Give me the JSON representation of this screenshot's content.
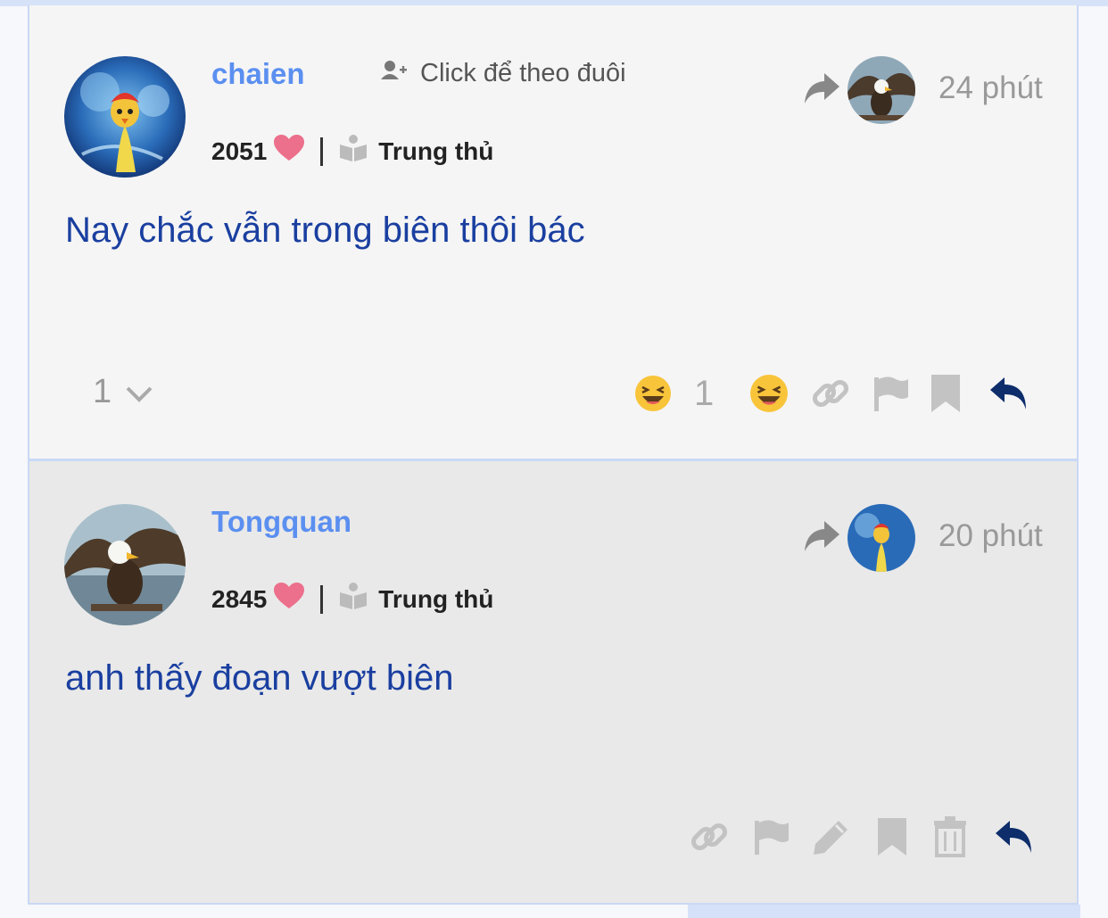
{
  "posts": [
    {
      "username": "chaien",
      "follow_label": "Click để theo đuôi",
      "likes": "2051",
      "rank": "Trung thủ",
      "time": "24 phút",
      "content": "Nay chắc vẫn trong biên thôi bác",
      "vote_count": "1",
      "reaction_count": "1"
    },
    {
      "username": "Tongquan",
      "likes": "2845",
      "rank": "Trung thủ",
      "time": "20 phút",
      "content": "anh thấy đoạn vượt biên"
    }
  ],
  "icons": {
    "follow": "add-user-icon",
    "heart": "heart-icon",
    "rank": "book-icon",
    "share": "share-arrow-icon",
    "vote_toggle": "chevron-down-icon",
    "reaction": "laughing-emoji-icon",
    "link": "link-icon",
    "flag": "flag-icon",
    "edit": "pencil-icon",
    "bookmark": "bookmark-icon",
    "delete": "trash-icon",
    "reply": "reply-icon"
  },
  "colors": {
    "username": "#5b8ff0",
    "content": "#1a3fa0",
    "heart": "#ec6f8b",
    "reply": "#0d2d6b",
    "icon_gray": "#c3c3c3"
  }
}
